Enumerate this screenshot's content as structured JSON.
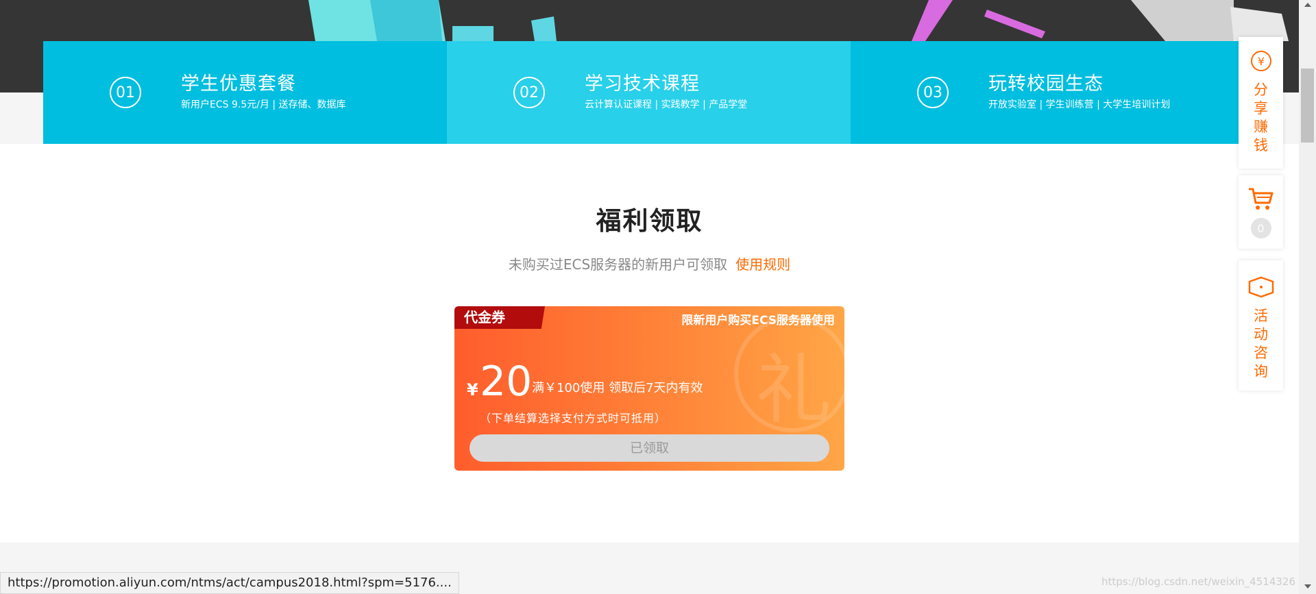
{
  "features": [
    {
      "num": "01",
      "title": "学生优惠套餐",
      "desc": "新用户ECS 9.5元/月 | 送存储、数据库"
    },
    {
      "num": "02",
      "title": "学习技术课程",
      "desc": "云计算认证课程 | 实践教学 | 产品学堂"
    },
    {
      "num": "03",
      "title": "玩转校园生态",
      "desc": "开放实验室 | 学生训练营 | 大学生培训计划"
    }
  ],
  "welfare": {
    "title": "福利领取",
    "subtitle": "未购买过ECS服务器的新用户可领取",
    "rule_link": "使用规则"
  },
  "coupon": {
    "tag": "代金券",
    "limit": "限新用户购买ECS服务器使用",
    "currency": "¥",
    "amount": "20",
    "condition": "满￥100使用 领取后7天内有效",
    "note": "（下单结算选择支付方式时可抵用）",
    "status_button": "已领取",
    "watermark_glyph": "礼"
  },
  "sidebar_tools": {
    "share_icon_glyph": "¥",
    "share": [
      "分",
      "享",
      "赚",
      "钱"
    ],
    "cart_count": "0",
    "consult": [
      "活",
      "动",
      "咨",
      "询"
    ]
  },
  "statusbar": {
    "url": "https://promotion.aliyun.com/ntms/act/campus2018.html?spm=5176...."
  },
  "watermark": "https://blog.csdn.net/weixin_4514326",
  "colors": {
    "accent": "#ff6a00",
    "feature_primary": "#00bedf",
    "feature_mid": "#28d0ea"
  }
}
